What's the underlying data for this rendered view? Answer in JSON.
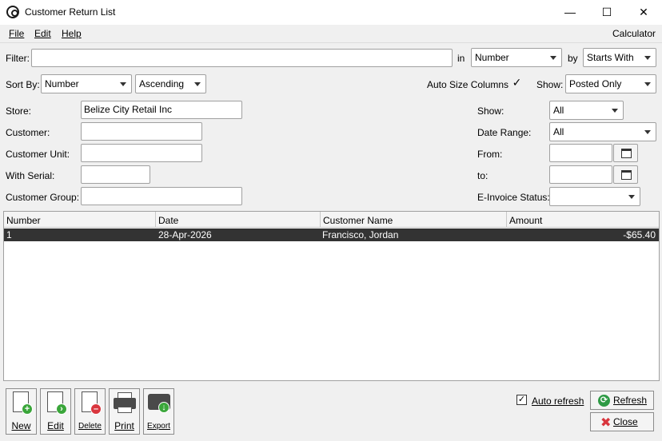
{
  "window": {
    "title": "Customer Return List",
    "minimize": "—",
    "maximize": "☐",
    "close": "✕"
  },
  "menu": {
    "file": "File",
    "edit": "Edit",
    "help": "Help",
    "calculator": "Calculator"
  },
  "filter": {
    "label": "Filter:",
    "value": "",
    "in_label": "in",
    "in_value": "Number",
    "by_label": "by",
    "by_value": "Starts With"
  },
  "sort": {
    "label": "Sort By:",
    "field": "Number",
    "order": "Ascending",
    "auto_size_label": "Auto Size Columns",
    "auto_size_checked": "✓",
    "show_label": "Show:",
    "show_value": "Posted Only"
  },
  "criteria": {
    "store_label": "Store:",
    "store_value": "Belize City Retail Inc",
    "customer_label": "Customer:",
    "customer_value": "",
    "unit_label": "Customer Unit:",
    "unit_value": "",
    "serial_label": "With Serial:",
    "serial_value": "",
    "group_label": "Customer Group:",
    "group_value": "",
    "show_label": "Show:",
    "show_value": "All",
    "date_range_label": "Date Range:",
    "date_range_value": "All",
    "from_label": "From:",
    "from_value": "",
    "to_label": "to:",
    "to_value": "",
    "einvoice_label": "E-Invoice Status:",
    "einvoice_value": ""
  },
  "table": {
    "columns": [
      "Number",
      "Date",
      "Customer Name",
      "Amount"
    ],
    "rows": [
      {
        "number": "1",
        "date": "28-Apr-2026",
        "customer": "Francisco, Jordan",
        "amount": "-$65.40"
      }
    ]
  },
  "toolbar": {
    "new": "New",
    "edit": "Edit",
    "delete": "Delete",
    "print": "Print",
    "export": "Export"
  },
  "footer": {
    "auto_refresh_label": "Auto refresh",
    "auto_refresh_checked": "✓",
    "refresh": "Refresh",
    "close": "Close"
  },
  "colors": {
    "selected_row": "#333333",
    "add_green": "#3aa63a",
    "delete_red": "#d9363e",
    "refresh_green": "#2e9a45"
  }
}
